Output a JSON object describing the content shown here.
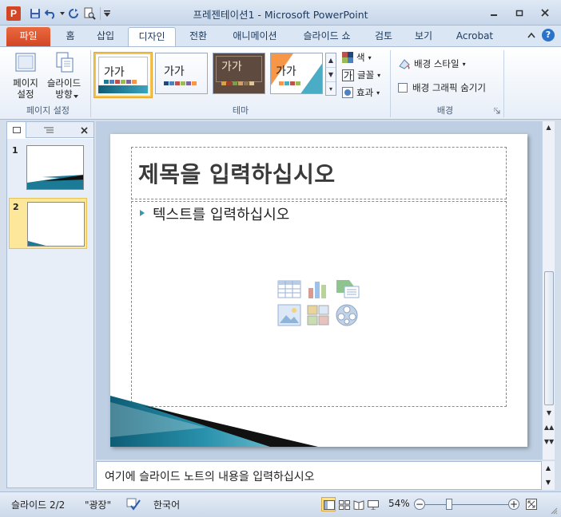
{
  "window": {
    "title": "프레젠테이션1 - Microsoft PowerPoint",
    "app_icon_letter": "P"
  },
  "tabs": [
    {
      "label": "파일"
    },
    {
      "label": "홈"
    },
    {
      "label": "삽입"
    },
    {
      "label": "디자인"
    },
    {
      "label": "전환"
    },
    {
      "label": "애니메이션"
    },
    {
      "label": "슬라이드 쇼"
    },
    {
      "label": "검토"
    },
    {
      "label": "보기"
    },
    {
      "label": "Acrobat"
    }
  ],
  "active_tab": "디자인",
  "ribbon": {
    "page_setup": {
      "group_label": "페이지 설정",
      "page_setup_button": "페이지\n설정",
      "orientation_button": "슬라이드\n방향"
    },
    "themes": {
      "group_label": "테마",
      "items": [
        {
          "label": "가가"
        },
        {
          "label": "가가"
        },
        {
          "label": "가가"
        },
        {
          "label": "가가"
        }
      ],
      "colors_label": "색",
      "fonts_label": "글꼴",
      "fonts_icon_glyph": "가",
      "effects_label": "효과"
    },
    "background": {
      "group_label": "배경",
      "styles_label": "배경 스타일",
      "hide_graphics_label": "배경 그래픽 숨기기"
    }
  },
  "slides_pane": {
    "thumbnails": [
      {
        "number": "1"
      },
      {
        "number": "2"
      }
    ]
  },
  "slide": {
    "title_placeholder": "제목을 입력하십시오",
    "body_placeholder": "텍스트를 입력하십시오"
  },
  "notes": {
    "placeholder": "여기에 슬라이드 노트의 내용을 입력하십시오"
  },
  "status": {
    "slide_counter": "슬라이드 2/2",
    "theme_name": "\"광장\"",
    "language": "한국어",
    "zoom": "54%"
  },
  "colors": {
    "accent": "#2b72c9",
    "file_tab": "#d24625",
    "theme_teal": "#1b7a96"
  }
}
